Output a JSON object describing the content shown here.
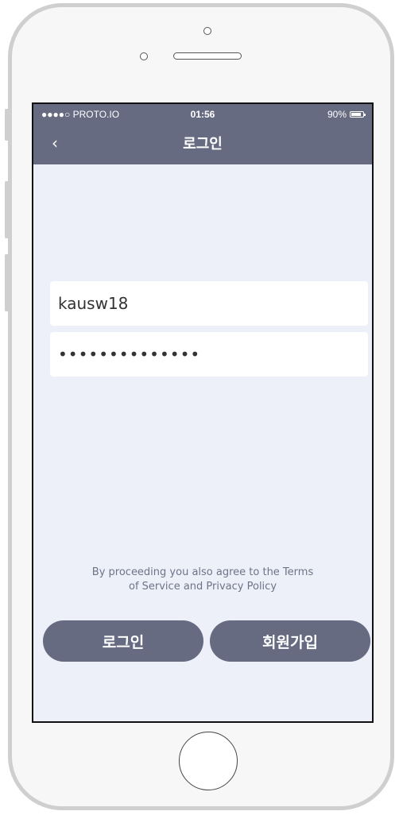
{
  "status_bar": {
    "carrier": "●●●●○ PROTO.IO",
    "time": "01:56",
    "battery": "90%"
  },
  "nav": {
    "back_icon": "‹",
    "title": "로그인"
  },
  "form": {
    "username_value": "kausw18",
    "password_value": "••••••••••••••"
  },
  "terms": {
    "line1": "By proceeding you also agree to the Terms",
    "line2": "of Service and Privacy Policy"
  },
  "buttons": {
    "login_label": "로그인",
    "signup_label": "회원가입"
  },
  "colors": {
    "accent": "#666b82",
    "screen_bg": "#edf0f8"
  }
}
